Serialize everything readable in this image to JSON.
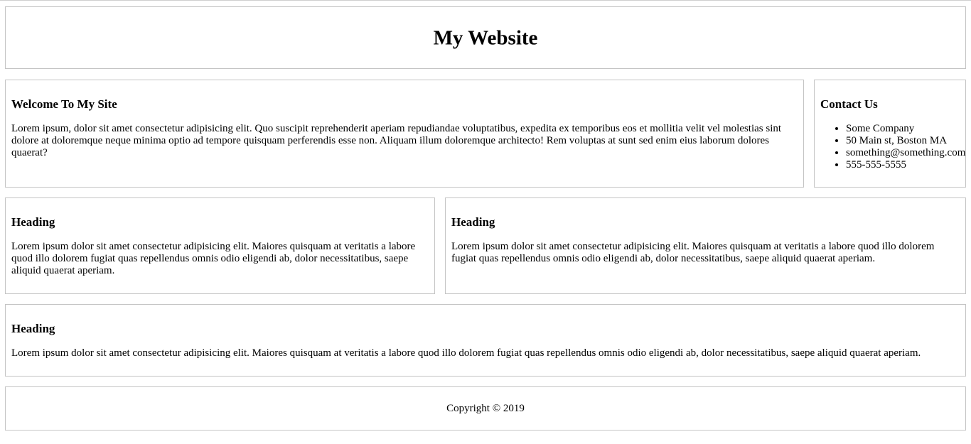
{
  "header": {
    "title": "My Website"
  },
  "welcome": {
    "heading": "Welcome To My Site",
    "text": "Lorem ipsum, dolor sit amet consectetur adipisicing elit. Quo suscipit reprehenderit aperiam repudiandae voluptatibus, expedita ex temporibus eos et mollitia velit vel molestias sint dolore at doloremque neque minima optio ad tempore quisquam perferendis esse non. Aliquam illum doloremque architecto! Rem voluptas at sunt sed enim eius laborum dolores quaerat?"
  },
  "contact": {
    "heading": "Contact Us",
    "items": [
      "Some Company",
      "50 Main st, Boston MA",
      "something@something.com",
      "555-555-5555"
    ]
  },
  "cards": [
    {
      "heading": "Heading",
      "text": "Lorem ipsum dolor sit amet consectetur adipisicing elit. Maiores quisquam at veritatis a labore quod illo dolorem fugiat quas repellendus omnis odio eligendi ab, dolor necessitatibus, saepe aliquid quaerat aperiam."
    },
    {
      "heading": "Heading",
      "text": "Lorem ipsum dolor sit amet consectetur adipisicing elit. Maiores quisquam at veritatis a labore quod illo dolorem fugiat quas repellendus omnis odio eligendi ab, dolor necessitatibus, saepe aliquid quaerat aperiam."
    },
    {
      "heading": "Heading",
      "text": "Lorem ipsum dolor sit amet consectetur adipisicing elit. Maiores quisquam at veritatis a labore quod illo dolorem fugiat quas repellendus omnis odio eligendi ab, dolor necessitatibus, saepe aliquid quaerat aperiam."
    }
  ],
  "footer": {
    "copyright": "Copyright © 2019"
  }
}
